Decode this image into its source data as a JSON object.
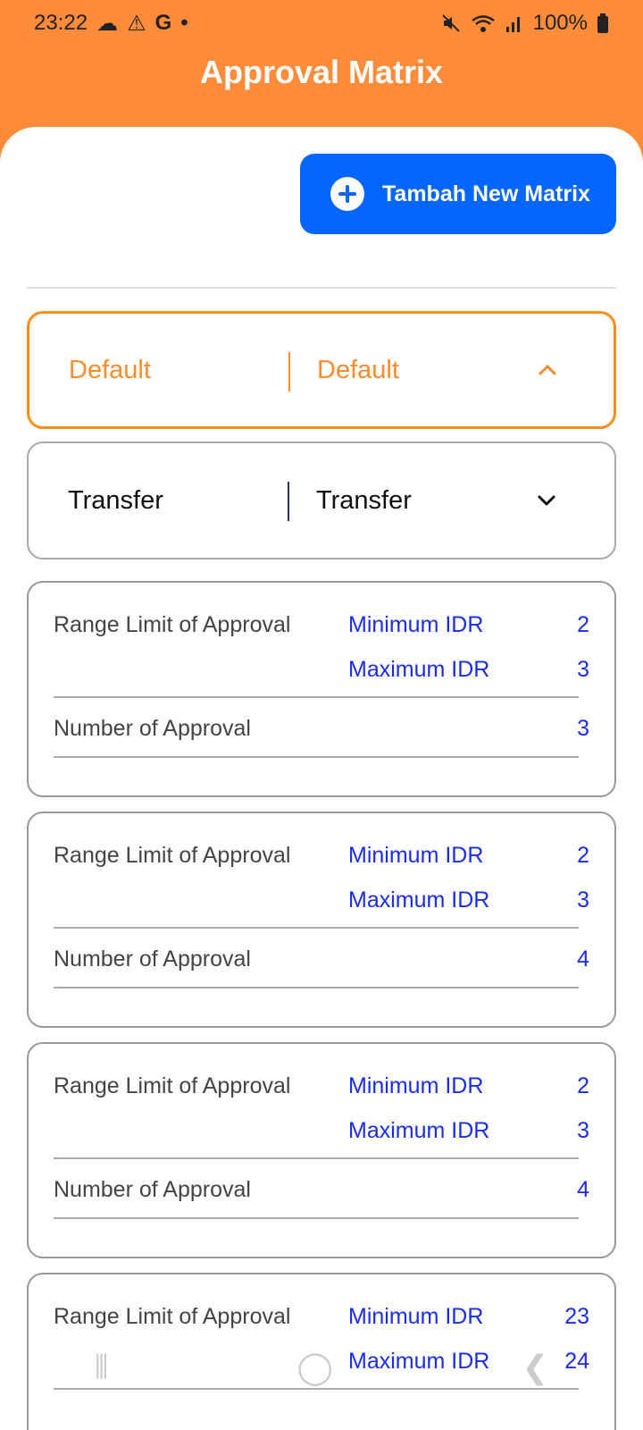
{
  "status_bar": {
    "time": "23:22",
    "left_icons": [
      "cloud-icon",
      "warning-icon",
      "google-icon",
      "dot-icon"
    ],
    "battery": "100%",
    "right_icons": [
      "mute-icon",
      "wifi-icon",
      "signal-icon",
      "battery-icon"
    ]
  },
  "header": {
    "title": "Approval Matrix"
  },
  "actions": {
    "add_label": "Tambah New Matrix"
  },
  "colors": {
    "brand": "#ff8c3a",
    "accent": "#0565ff",
    "value_blue": "#1a2cf0",
    "active_border": "#ff8c1a"
  },
  "selectors": [
    {
      "left": "Default",
      "right": "Default",
      "state": "expanded",
      "icon": "chevron-up-icon"
    },
    {
      "left": "Transfer",
      "right": "Transfer",
      "state": "collapsed",
      "icon": "chevron-down-icon"
    }
  ],
  "labels": {
    "range": "Range Limit of Approval",
    "min": "Minimum IDR",
    "max": "Maximum IDR",
    "number": "Number of Approval"
  },
  "cards": [
    {
      "min": "2",
      "max": "3",
      "number": "3"
    },
    {
      "min": "2",
      "max": "3",
      "number": "4"
    },
    {
      "min": "2",
      "max": "3",
      "number": "4"
    },
    {
      "min": "23",
      "max": "24",
      "number": ""
    }
  ],
  "nav_bar": {
    "icons": [
      "recent-apps-icon",
      "home-icon",
      "back-icon"
    ],
    "glyphs": [
      "⦀",
      "◯",
      "❮"
    ]
  }
}
